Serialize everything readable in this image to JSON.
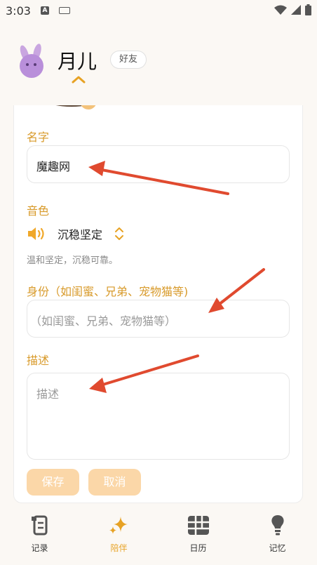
{
  "status_bar": {
    "time": "3:03",
    "notification_badge": "A"
  },
  "header": {
    "character_name": "月儿",
    "relation_badge": "好友"
  },
  "form": {
    "name_label": "名字",
    "name_value": "魔趣网",
    "voice_label": "音色",
    "voice_name": "沉稳坚定",
    "voice_description": "温和坚定，沉稳可靠。",
    "identity_label": "身份（如闺蜜、兄弟、宠物猫等)",
    "identity_placeholder": "（如闺蜜、兄弟、宠物猫等）",
    "description_label": "描述",
    "description_placeholder": "描述",
    "save_button": "保存",
    "cancel_button": "取消"
  },
  "tabs": [
    {
      "label": "记录",
      "icon": "scroll-icon",
      "active": false
    },
    {
      "label": "陪伴",
      "icon": "sparkle-icon",
      "active": true
    },
    {
      "label": "日历",
      "icon": "calendar-grid-icon",
      "active": false
    },
    {
      "label": "记忆",
      "icon": "lightbulb-icon",
      "active": false
    }
  ],
  "colors": {
    "accent": "#e7a224",
    "label": "#d89a2a",
    "button_disabled": "#fbd7a8",
    "annotation_arrow": "#e04a2f"
  }
}
